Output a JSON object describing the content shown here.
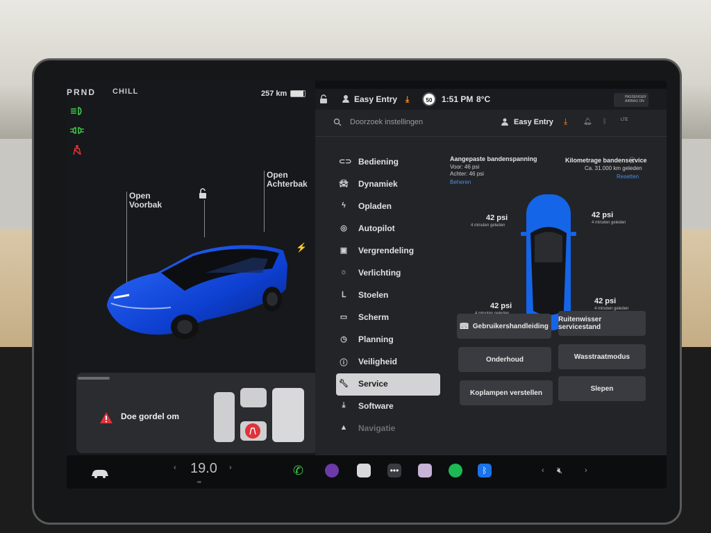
{
  "top_bar": {
    "gears": "PRND",
    "drive_mode": "CHILL",
    "range": "257 km",
    "battery_level": 0.9
  },
  "car_view": {
    "frunk_label_1": "Open",
    "frunk_label_2": "Voorbak",
    "trunk_label_1": "Open",
    "trunk_label_2": "Achterbak"
  },
  "seatbelt_alert": {
    "text": "Doe gordel om"
  },
  "status_bar": {
    "profile": "Easy Entry",
    "speed_limit": "50",
    "time": "1:51 PM",
    "temperature": "8°C",
    "airbag": "PASSENGER AIRBAG ON"
  },
  "settings": {
    "search_placeholder": "Doorzoek instellingen",
    "profile": "Easy Entry",
    "menu": [
      {
        "label": "Bediening",
        "icon": "toggle-icon"
      },
      {
        "label": "Dynamiek",
        "icon": "car-icon"
      },
      {
        "label": "Opladen",
        "icon": "bolt-icon"
      },
      {
        "label": "Autopilot",
        "icon": "steering-wheel-icon"
      },
      {
        "label": "Vergrendeling",
        "icon": "lock-icon"
      },
      {
        "label": "Verlichting",
        "icon": "light-icon"
      },
      {
        "label": "Stoelen",
        "icon": "seat-icon"
      },
      {
        "label": "Scherm",
        "icon": "display-icon"
      },
      {
        "label": "Planning",
        "icon": "clock-icon"
      },
      {
        "label": "Veiligheid",
        "icon": "info-icon"
      },
      {
        "label": "Service",
        "icon": "wrench-icon"
      },
      {
        "label": "Software",
        "icon": "download-icon"
      },
      {
        "label": "Navigatie",
        "icon": "navigation-icon"
      }
    ],
    "tyre_title": "Aangepaste bandenspanning",
    "front_line": "Voor: 46 psi",
    "rear_line": "Achter: 46 psi",
    "manage_link": "Beheren",
    "service_title": "Kilometrage bandenservice",
    "service_since": "Ca. 31.000 km geleden",
    "reset_link": "Resetten",
    "tyres": [
      {
        "value": "42 psi",
        "time": "4 minuten geleden"
      },
      {
        "value": "42 psi",
        "time": "4 minuten geleden"
      },
      {
        "value": "42 psi",
        "time": "4 minuten geleden"
      },
      {
        "value": "42 psi",
        "time": "4 minuten geleden"
      }
    ],
    "buttons": {
      "manual": "Gebruikershandleiding",
      "wiper": "Ruitenwisser servicestand",
      "maintenance": "Onderhoud",
      "carwash": "Wasstraatmodus",
      "headlights": "Koplampen verstellen",
      "tow": "Slepen"
    }
  },
  "dock": {
    "temperature": "19.0"
  },
  "colors": {
    "accent_blue": "#4a90e2",
    "alert_red": "#e0323a",
    "green": "#3ecf4c"
  }
}
